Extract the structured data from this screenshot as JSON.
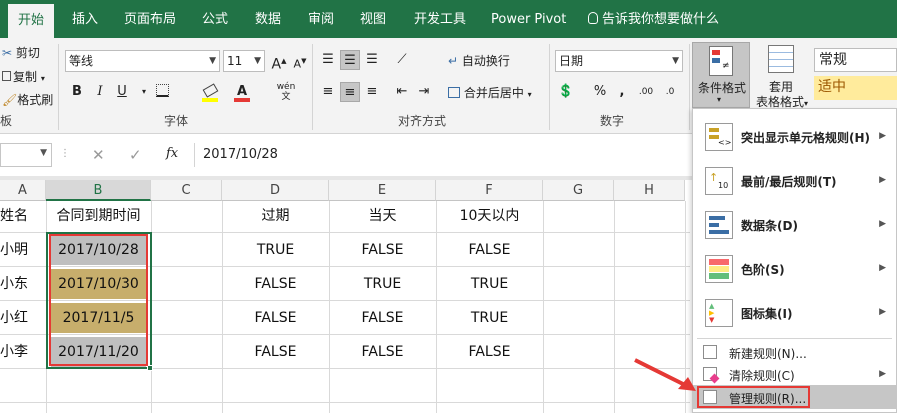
{
  "tabs": [
    {
      "label": "开始",
      "active": true
    },
    {
      "label": "插入"
    },
    {
      "label": "页面布局"
    },
    {
      "label": "公式"
    },
    {
      "label": "数据"
    },
    {
      "label": "审阅"
    },
    {
      "label": "视图"
    },
    {
      "label": "开发工具"
    },
    {
      "label": "Power Pivot"
    }
  ],
  "tell_me": "告诉我你想要做什么",
  "ribbon": {
    "clipboard": {
      "cut": "剪切",
      "copy": "复制",
      "format_painter": "格式刷",
      "label": "板"
    },
    "font": {
      "name": "等线",
      "size": "11",
      "label": "字体",
      "bold": "B",
      "italic": "I",
      "underline": "U",
      "font_color_letter": "A",
      "phonetic": "wén"
    },
    "alignment": {
      "wrap": "自动换行",
      "merge": "合并后居中",
      "label": "对齐方式"
    },
    "number": {
      "format": "日期",
      "label": "数字",
      "percent": "%",
      "comma": ","
    },
    "styles": {
      "conditional": "条件格式",
      "table_line1": "套用",
      "table_line2": "表格格式",
      "style_normal": "常规",
      "style_neutral": "适中"
    }
  },
  "formula_bar": {
    "fx": "fx",
    "value": "2017/10/28"
  },
  "columns": [
    "A",
    "B",
    "C",
    "D",
    "E",
    "F",
    "G",
    "H"
  ],
  "rows": [
    [
      "姓名",
      "合同到期时间",
      "",
      "过期",
      "当天",
      "10天以内"
    ],
    [
      "小明",
      "2017/10/28",
      "",
      "TRUE",
      "FALSE",
      "FALSE"
    ],
    [
      "小东",
      "2017/10/30",
      "",
      "FALSE",
      "TRUE",
      "TRUE"
    ],
    [
      "小红",
      "2017/11/5",
      "",
      "FALSE",
      "FALSE",
      "TRUE"
    ],
    [
      "小李",
      "2017/11/20",
      "",
      "FALSE",
      "FALSE",
      "FALSE"
    ]
  ],
  "colors": {
    "excel_green": "#217346",
    "cell_gray": "#bfbfbf",
    "cell_tan": "#c7ae6c",
    "highlight_red": "#e53935",
    "menu_hover": "#c6c6c6",
    "neutral_fill": "#ffeb9c"
  },
  "menu": {
    "items": [
      {
        "label": "突出显示单元格规则(H)",
        "icon": "highlight-cells-icon",
        "submenu": true
      },
      {
        "label": "最前/最后规则(T)",
        "icon": "top-bottom-icon",
        "submenu": true
      },
      {
        "label": "数据条(D)",
        "icon": "data-bars-icon",
        "submenu": true
      },
      {
        "label": "色阶(S)",
        "icon": "color-scales-icon",
        "submenu": true
      },
      {
        "label": "图标集(I)",
        "icon": "icon-sets-icon",
        "submenu": true
      }
    ],
    "small_items": [
      {
        "label": "新建规则(N)...",
        "icon": "new-rule-icon",
        "submenu": false
      },
      {
        "label": "清除规则(C)",
        "icon": "clear-rules-icon",
        "submenu": true
      },
      {
        "label": "管理规则(R)...",
        "icon": "manage-rules-icon",
        "submenu": false
      }
    ]
  }
}
